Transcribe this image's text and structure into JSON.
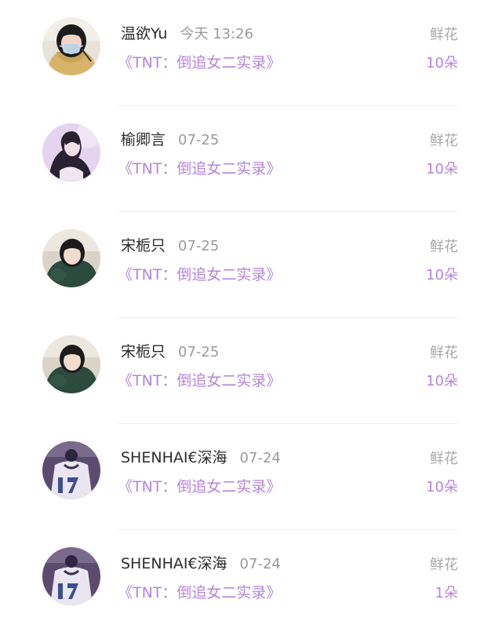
{
  "colors": {
    "accent": "#b683dc",
    "name_text": "#2c2c2c",
    "muted_text": "#9a9a9a",
    "divider": "#eeeeee"
  },
  "records": [
    {
      "username": "温欲Yu",
      "timestamp": "今天 13:26",
      "book": "《TNT：倒追女二实录》",
      "gift_type": "鲜花",
      "gift_count": "10朵",
      "avatar_icon": "user-avatar-masked-girl"
    },
    {
      "username": "榆卿言",
      "timestamp": "07-25",
      "book": "《TNT：倒追女二实录》",
      "gift_type": "鲜花",
      "gift_count": "10朵",
      "avatar_icon": "user-avatar-girl-lilac"
    },
    {
      "username": "宋栀只",
      "timestamp": "07-25",
      "book": "《TNT：倒追女二实录》",
      "gift_type": "鲜花",
      "gift_count": "10朵",
      "avatar_icon": "user-avatar-girl-green"
    },
    {
      "username": "宋栀只",
      "timestamp": "07-25",
      "book": "《TNT：倒追女二实录》",
      "gift_type": "鲜花",
      "gift_count": "10朵",
      "avatar_icon": "user-avatar-girl-green"
    },
    {
      "username": "SHENHAI€深海",
      "timestamp": "07-24",
      "book": "《TNT：倒追女二实录》",
      "gift_type": "鲜花",
      "gift_count": "10朵",
      "avatar_icon": "user-avatar-jersey-17"
    },
    {
      "username": "SHENHAI€深海",
      "timestamp": "07-24",
      "book": "《TNT：倒追女二实录》",
      "gift_type": "鲜花",
      "gift_count": "1朵",
      "avatar_icon": "user-avatar-jersey-17"
    }
  ]
}
